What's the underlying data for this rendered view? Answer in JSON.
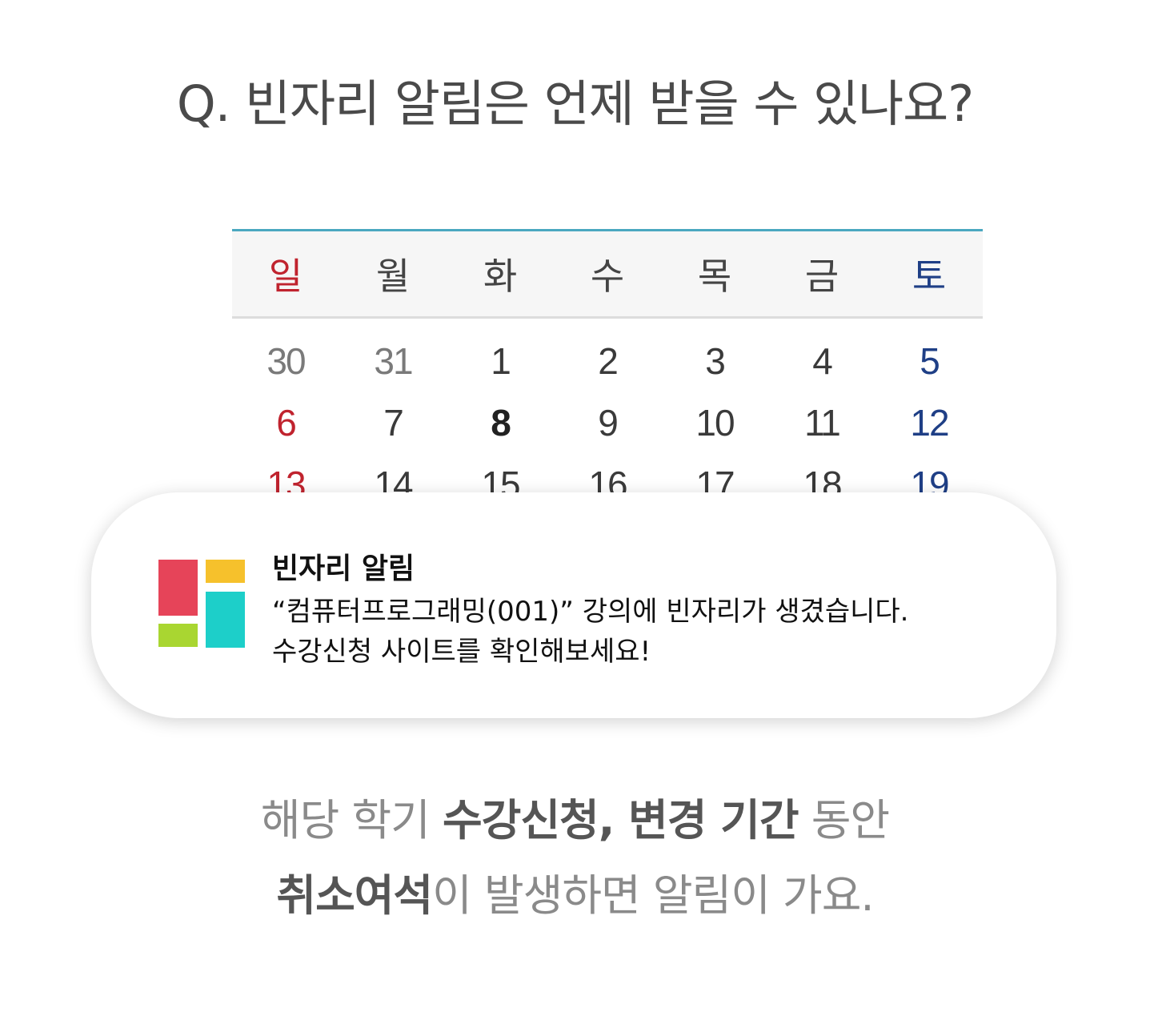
{
  "title": "Q. 빈자리 알림은 언제 받을 수 있나요?",
  "calendar": {
    "accent_color": "#4aa8c0",
    "weekdays": [
      "일",
      "월",
      "화",
      "수",
      "목",
      "금",
      "토"
    ],
    "weeks": [
      [
        "30",
        "31",
        "1",
        "2",
        "3",
        "4",
        "5"
      ],
      [
        "6",
        "7",
        "8",
        "9",
        "10",
        "11",
        "12"
      ],
      [
        "13",
        "14",
        "15",
        "16",
        "17",
        "18",
        "19"
      ]
    ],
    "highlighted_date": "8",
    "sunday_color": "#c0232e",
    "saturday_color": "#1f3f86"
  },
  "notification": {
    "title": "빈자리 알림",
    "line1": "“컴퓨터프로그래밍(001)” 강의에 빈자리가 생겼습니다.",
    "line2": "수강신청 사이트를 확인해보세요!",
    "logo_colors": [
      "#e64459",
      "#f6c12c",
      "#a9d631",
      "#1dcfc9"
    ]
  },
  "footer": {
    "line1_pre": "해당 학기 ",
    "line1_bold": "수강신청, 변경 기간",
    "line1_post": " 동안",
    "line2_bold": "취소여석",
    "line2_post": "이 발생하면 알림이 가요."
  }
}
